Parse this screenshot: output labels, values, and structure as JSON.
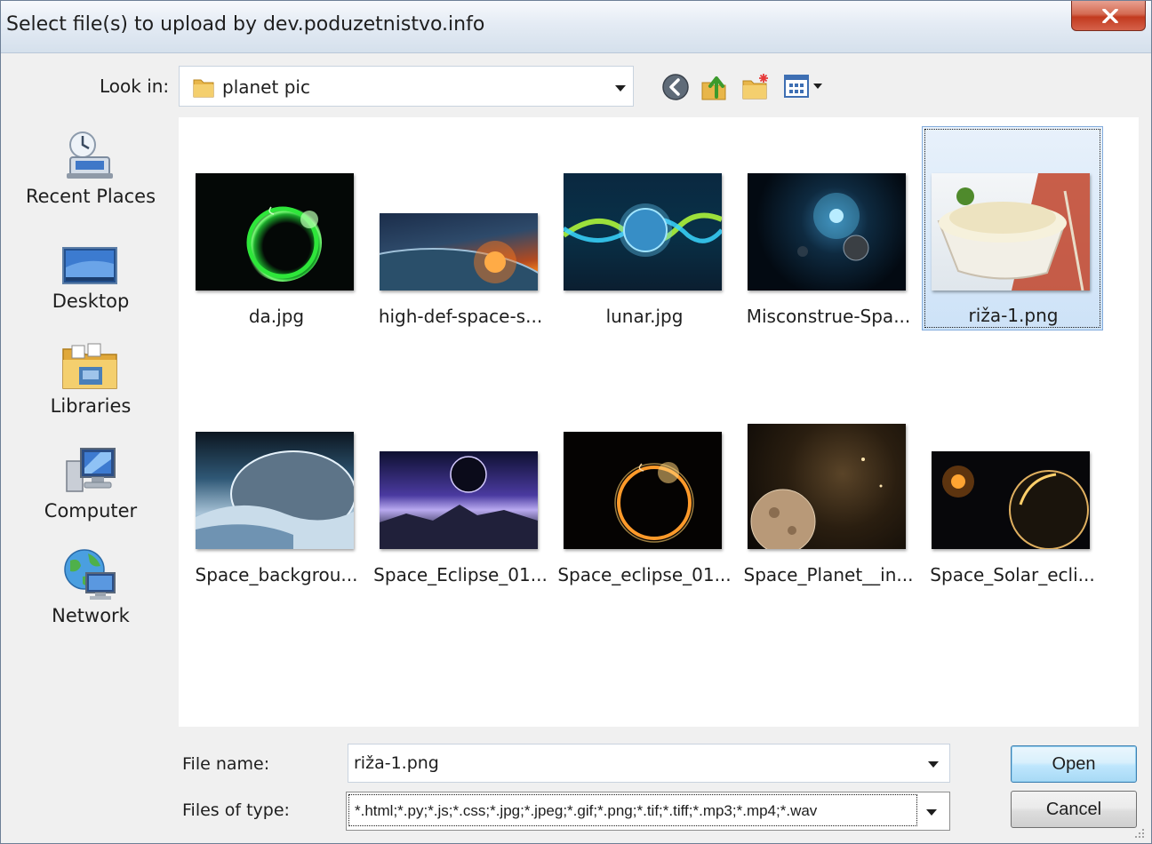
{
  "window": {
    "title": "Select file(s) to upload by dev.poduzetnistvo.info",
    "close_symbol": "X"
  },
  "toolbar": {
    "look_in_label": "Look in:",
    "look_in_value": "planet pic",
    "icons": [
      "back-icon",
      "up-folder-icon",
      "new-folder-icon",
      "views-menu-icon"
    ]
  },
  "places": [
    {
      "label": "Recent Places",
      "icon": "recent-places-icon"
    },
    {
      "label": "Desktop",
      "icon": "desktop-icon"
    },
    {
      "label": "Libraries",
      "icon": "libraries-icon"
    },
    {
      "label": "Computer",
      "icon": "computer-icon"
    },
    {
      "label": "Network",
      "icon": "network-icon"
    }
  ],
  "files": [
    {
      "name": "da.jpg",
      "selected": false
    },
    {
      "name": "high-def-space-s...",
      "selected": false
    },
    {
      "name": "lunar.jpg",
      "selected": false
    },
    {
      "name": "Misconstrue-Spa...",
      "selected": false
    },
    {
      "name": "riža-1.png",
      "selected": true
    },
    {
      "name": "Space_backgrou...",
      "selected": false
    },
    {
      "name": "Space_Eclipse_01...",
      "selected": false
    },
    {
      "name": "Space_eclipse_01...",
      "selected": false
    },
    {
      "name": "Space_Planet__in...",
      "selected": false
    },
    {
      "name": "Space_Solar_ecli...",
      "selected": false
    }
  ],
  "bottom": {
    "file_name_label": "File name:",
    "file_name_value": "riža-1.png",
    "file_type_label": "Files of type:",
    "file_type_value": "*.html;*.py;*.js;*.css;*.jpg;*.jpeg;*.gif;*.png;*.tif;*.tiff;*.mp3;*.mp4;*.wav",
    "open_label": "Open",
    "cancel_label": "Cancel"
  }
}
